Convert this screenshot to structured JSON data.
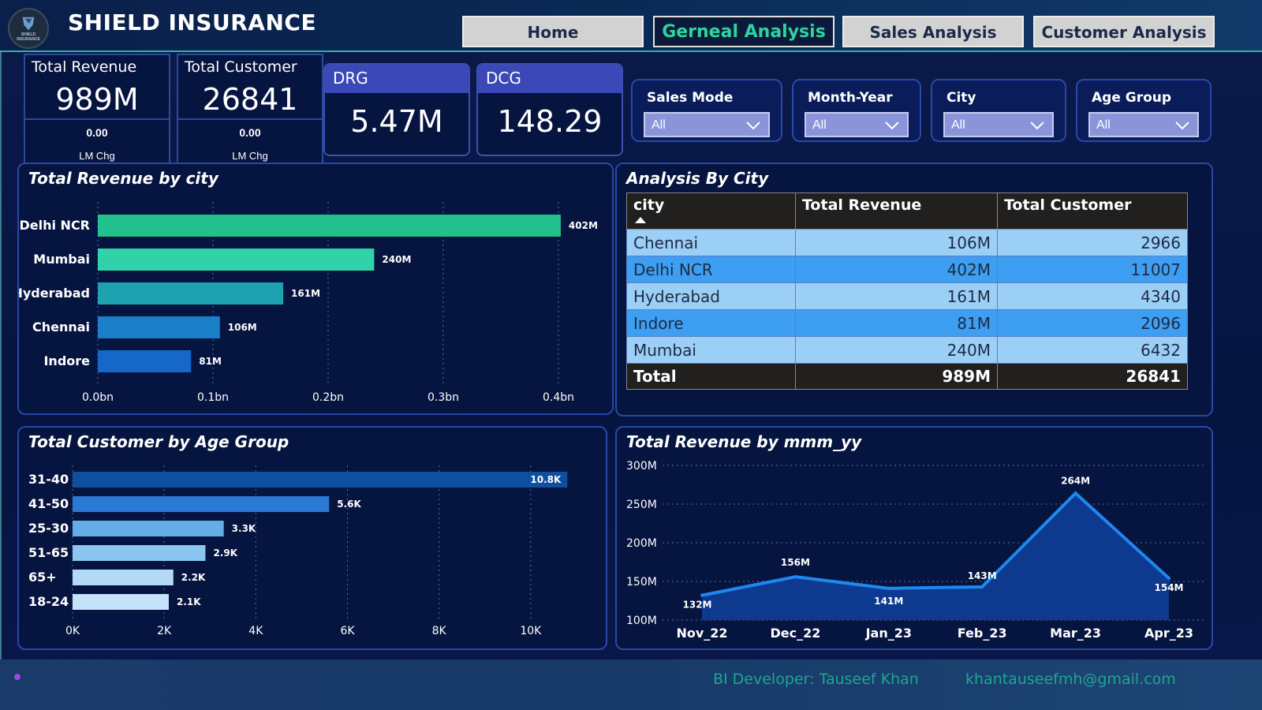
{
  "header": {
    "logo_text": "SHIELD INSURANCE",
    "title": "SHIELD INSURANCE",
    "nav": [
      {
        "label": "Home",
        "active": false
      },
      {
        "label": "Gerneal Analysis",
        "active": true
      },
      {
        "label": "Sales Analysis",
        "active": false
      },
      {
        "label": "Customer Analysis",
        "active": false
      }
    ]
  },
  "kpis": {
    "total_revenue": {
      "label": "Total Revenue",
      "value": "989M",
      "change": "0.00",
      "change_label": "LM Chg"
    },
    "total_customer": {
      "label": "Total Customer",
      "value": "26841",
      "change": "0.00",
      "change_label": "LM Chg"
    },
    "drg": {
      "label": "DRG",
      "value": "5.47M"
    },
    "dcg": {
      "label": "DCG",
      "value": "148.29"
    }
  },
  "slicers": [
    {
      "label": "Sales Mode",
      "value": "All"
    },
    {
      "label": "Month-Year",
      "value": "All"
    },
    {
      "label": "City",
      "value": "All"
    },
    {
      "label": "Age Group",
      "value": "All"
    }
  ],
  "panels": {
    "revenue_by_city": "Total Revenue by city",
    "analysis_by_city": "Analysis By City",
    "customer_by_age": "Total Customer by Age Group",
    "revenue_by_month": "Total Revenue by mmm_yy"
  },
  "table": {
    "headers": [
      "city",
      "Total Revenue",
      "Total Customer"
    ],
    "rows": [
      [
        "Chennai",
        "106M",
        "2966"
      ],
      [
        "Delhi NCR",
        "402M",
        "11007"
      ],
      [
        "Hyderabad",
        "161M",
        "4340"
      ],
      [
        "Indore",
        "81M",
        "2096"
      ],
      [
        "Mumbai",
        "240M",
        "6432"
      ]
    ],
    "total": [
      "Total",
      "989M",
      "26841"
    ]
  },
  "footer": {
    "developer": "BI Developer: Tauseef Khan",
    "email": "khantauseefmh@gmail.com"
  },
  "colors": {
    "accent": "#2ed3a0",
    "city_bars": [
      "#22c08c",
      "#30d3a8",
      "#1ea2b0",
      "#1a7fc8",
      "#1568c8"
    ],
    "age_bars": [
      "#0f4fa0",
      "#2a7ad4",
      "#64aee8",
      "#8cc6f0",
      "#b2daf6",
      "#c4e2f8"
    ],
    "line": "#1e88f0"
  },
  "chart_data": [
    {
      "type": "bar",
      "orientation": "horizontal",
      "title": "Total Revenue by city",
      "categories": [
        "Delhi NCR",
        "Mumbai",
        "Hyderabad",
        "Chennai",
        "Indore"
      ],
      "values": [
        402,
        240,
        161,
        106,
        81
      ],
      "value_labels": [
        "402M",
        "240M",
        "161M",
        "106M",
        "81M"
      ],
      "xlim": [
        0,
        400
      ],
      "xticks": [
        "0.0bn",
        "0.1bn",
        "0.2bn",
        "0.3bn",
        "0.4bn"
      ],
      "xtick_values": [
        0,
        100,
        200,
        300,
        400
      ],
      "grid": true
    },
    {
      "type": "bar",
      "orientation": "horizontal",
      "title": "Total Customer by Age Group",
      "categories": [
        "31-40",
        "41-50",
        "25-30",
        "51-65",
        "65+",
        "18-24"
      ],
      "values": [
        10800,
        5600,
        3300,
        2900,
        2200,
        2100
      ],
      "value_labels": [
        "10.8K",
        "5.6K",
        "3.3K",
        "2.9K",
        "2.2K",
        "2.1K"
      ],
      "xlim": [
        0,
        12000
      ],
      "xticks": [
        "0K",
        "2K",
        "4K",
        "6K",
        "8K",
        "10K"
      ],
      "xtick_values": [
        0,
        2000,
        4000,
        6000,
        8000,
        10000
      ],
      "grid": true
    },
    {
      "type": "area",
      "title": "Total Revenue by mmm_yy",
      "categories": [
        "Nov_22",
        "Dec_22",
        "Jan_23",
        "Feb_23",
        "Mar_23",
        "Apr_23"
      ],
      "values": [
        132,
        156,
        141,
        143,
        264,
        154
      ],
      "value_labels": [
        "132M",
        "156M",
        "141M",
        "143M",
        "264M",
        "154M"
      ],
      "ylim": [
        100,
        300
      ],
      "yticks": [
        "100M",
        "150M",
        "200M",
        "250M",
        "300M"
      ],
      "ytick_values": [
        100,
        150,
        200,
        250,
        300
      ],
      "grid": true
    }
  ]
}
